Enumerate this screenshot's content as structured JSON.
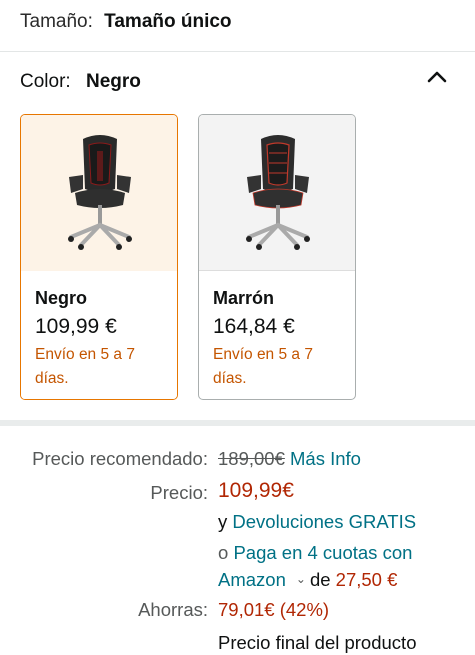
{
  "size": {
    "label": "Tamaño:",
    "value": "Tamaño único"
  },
  "color": {
    "label": "Color:",
    "value": "Negro"
  },
  "variants": [
    {
      "name": "Negro",
      "price": "109,99 €",
      "shipping": "Envío en 5 a 7 días.",
      "selected": true,
      "accent": "#8b1a1a"
    },
    {
      "name": "Marrón",
      "price": "164,84 €",
      "shipping": "Envío en 5 a 7 días.",
      "selected": false,
      "accent": "#c0392b"
    }
  ],
  "pricing": {
    "recommended_label": "Precio recomendado:",
    "recommended_price": "189,00€",
    "more_info": "Más Info",
    "price_label": "Precio:",
    "price": "109,99€",
    "returns_prefix": "y",
    "returns_link": "Devoluciones GRATIS",
    "installments_prefix": "o",
    "installments_link_line1": "Paga en 4 cuotas con",
    "installments_link_line2": "Amazon",
    "installments_of": "de",
    "installment_amount": "27,50 €",
    "savings_label": "Ahorras:",
    "savings": "79,01€ (42%)",
    "final_note": "Precio final del producto"
  },
  "colors": {
    "accent": "#e77600",
    "link": "#007185",
    "price_red": "#b12704",
    "shipping": "#c45500"
  }
}
